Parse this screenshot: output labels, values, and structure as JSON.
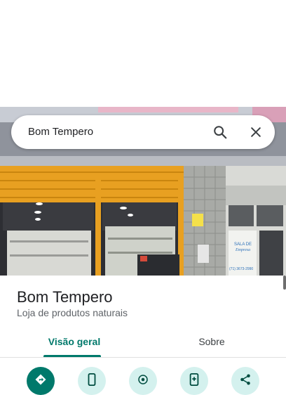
{
  "search": {
    "query": "Bom Tempero"
  },
  "photo": {
    "storefront_sign_line1": "SALA DE",
    "storefront_sign_line2": "Empresa",
    "storefront_phone": "(71) 3673-2990"
  },
  "place": {
    "name": "Bom Tempero",
    "category": "Loja de produtos naturais"
  },
  "tabs": [
    {
      "label": "Visão geral",
      "active": true
    },
    {
      "label": "Sobre",
      "active": false
    }
  ],
  "colors": {
    "accent": "#00796b",
    "action_bg": "#d4f1ee"
  },
  "actions": [
    {
      "icon": "directions-icon"
    },
    {
      "icon": "phone-icon"
    },
    {
      "icon": "location-icon"
    },
    {
      "icon": "save-icon"
    },
    {
      "icon": "share-icon"
    }
  ]
}
